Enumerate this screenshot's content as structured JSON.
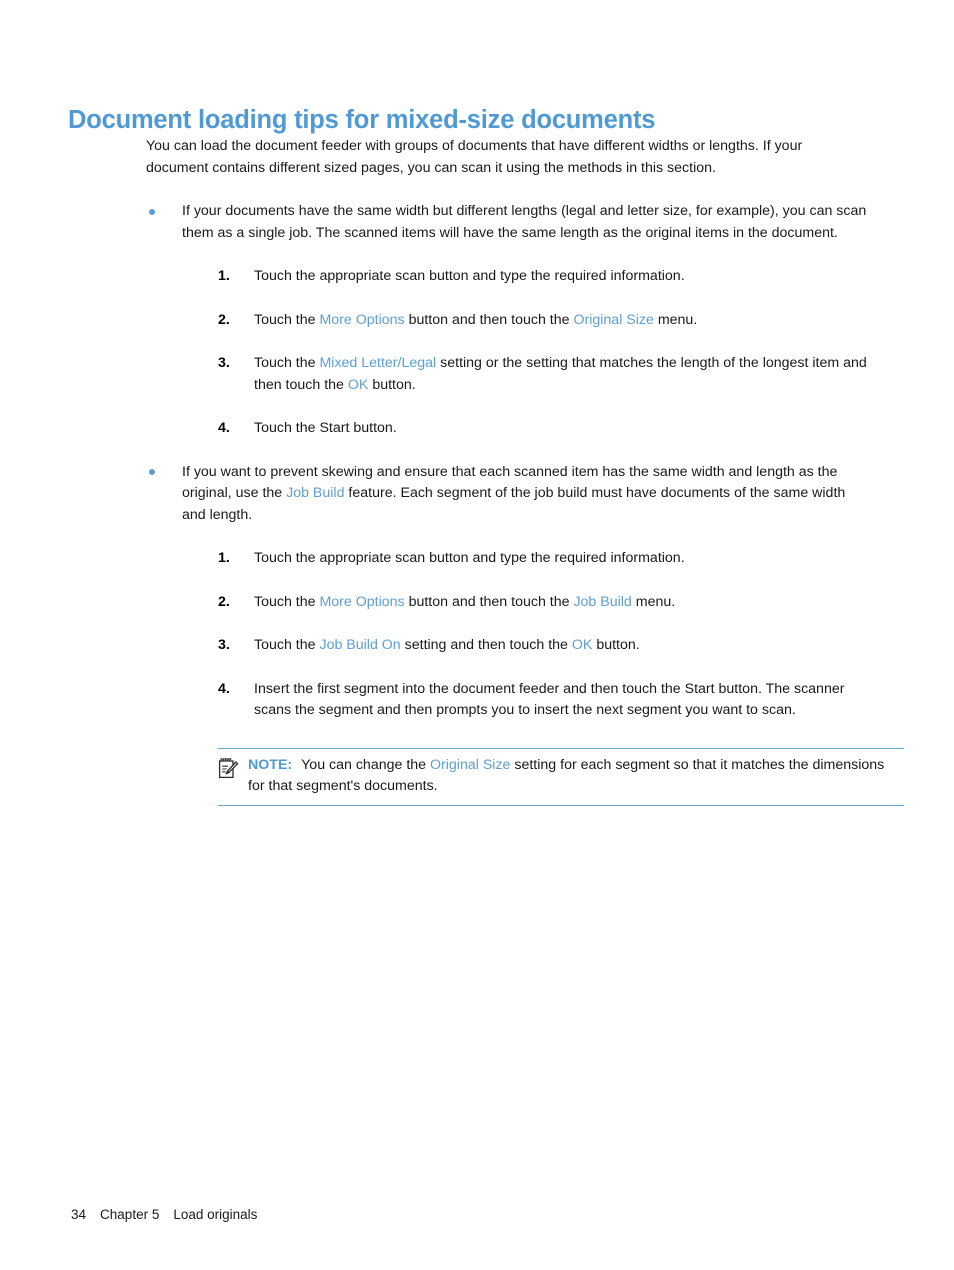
{
  "document": {
    "title": "Document loading tips for mixed-size documents",
    "intro": "You can load the document feeder with groups of documents that have different widths or lengths. If your document contains different sized pages, you can scan it using the methods in this section."
  },
  "bullets": [
    {
      "bullet_icon": "bullet-dot-icon",
      "text_part_1": "If your documents have the same width but different lengths (legal and letter size, for example), you can scan them as a single job. The scanned items will have the same length as the original items in the document.",
      "steps": [
        {
          "number": "1.",
          "segments": [
            {
              "text": "Touch the appropriate scan button and type the required information.",
              "ui": false
            }
          ]
        },
        {
          "number": "2.",
          "segments": [
            {
              "text": "Touch the ",
              "ui": false
            },
            {
              "text": "More Options",
              "ui": true
            },
            {
              "text": " button and then touch the ",
              "ui": false
            },
            {
              "text": "Original Size",
              "ui": true
            },
            {
              "text": " menu.",
              "ui": false
            }
          ]
        },
        {
          "number": "3.",
          "segments": [
            {
              "text": "Touch the ",
              "ui": false
            },
            {
              "text": "Mixed Letter/Legal",
              "ui": true
            },
            {
              "text": " setting or the setting that matches the length of the longest item and then touch the ",
              "ui": false
            },
            {
              "text": "OK",
              "ui": true
            },
            {
              "text": " button.",
              "ui": false
            }
          ]
        },
        {
          "number": "4.",
          "segments": [
            {
              "text": "Touch the Start button.",
              "ui": false
            }
          ]
        }
      ]
    },
    {
      "bullet_icon": "bullet-dot-icon",
      "text_segments": [
        {
          "text": "If you want to prevent skewing and ensure that each scanned item has the same width and length as the original, use the ",
          "ui": false
        },
        {
          "text": "Job Build",
          "ui": true
        },
        {
          "text": " feature. Each segment of the job build must have documents of the same width and length.",
          "ui": false
        }
      ],
      "steps": [
        {
          "number": "1.",
          "segments": [
            {
              "text": "Touch the appropriate scan button and type the required information.",
              "ui": false
            }
          ]
        },
        {
          "number": "2.",
          "segments": [
            {
              "text": "Touch the ",
              "ui": false
            },
            {
              "text": "More Options",
              "ui": true
            },
            {
              "text": " button and then touch the ",
              "ui": false
            },
            {
              "text": "Job Build",
              "ui": true
            },
            {
              "text": " menu.",
              "ui": false
            }
          ]
        },
        {
          "number": "3.",
          "segments": [
            {
              "text": "Touch the ",
              "ui": false
            },
            {
              "text": "Job Build On",
              "ui": true
            },
            {
              "text": " setting and then touch the ",
              "ui": false
            },
            {
              "text": "OK",
              "ui": true
            },
            {
              "text": " button.",
              "ui": false
            }
          ]
        },
        {
          "number": "4.",
          "segments": [
            {
              "text": "Insert the first segment into the document feeder and then touch the Start button. The scanner scans the segment and then prompts you to insert the next segment you want to scan.",
              "ui": false
            }
          ]
        }
      ]
    }
  ],
  "note": {
    "icon": "note-pad-pencil-icon",
    "label": "NOTE:",
    "segments": [
      {
        "text": "You can change the ",
        "ui": false
      },
      {
        "text": "Original Size",
        "ui": true
      },
      {
        "text": " setting for each segment so that it matches the dimensions for that segment's documents.",
        "ui": false
      }
    ]
  },
  "footer": {
    "page_number": "34",
    "chapter": "Chapter 5",
    "chapter_title": "Load originals"
  },
  "colors": {
    "title_blue": "#4f9ad4",
    "ui_term_blue": "#5d9fd4",
    "rule_blue": "#6aa5d6",
    "body_black": "#1a1a1a"
  }
}
